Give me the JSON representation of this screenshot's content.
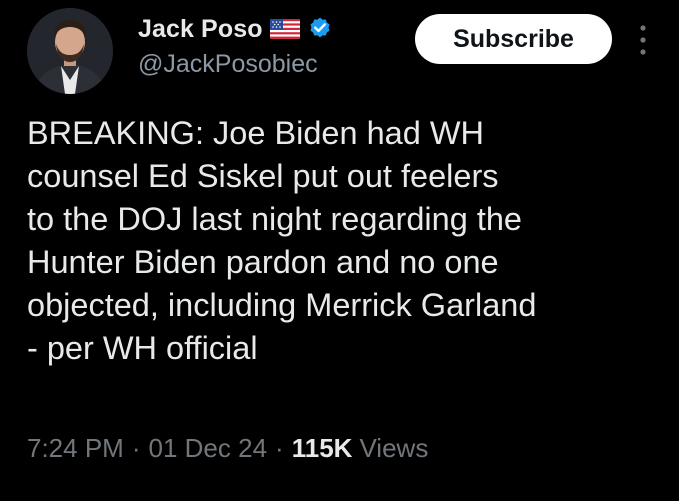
{
  "author": {
    "display_name": "Jack Poso",
    "handle": "@JackPosobiec",
    "flag_icon": "us-flag-icon",
    "verified_icon": "verified-badge-icon",
    "verified_color": "#1d9bf0"
  },
  "actions": {
    "subscribe_label": "Subscribe",
    "more_icon": "more-vertical-icon"
  },
  "tweet": {
    "lines": [
      "BREAKING: Joe Biden had WH",
      "counsel Ed Siskel put out feelers",
      "to the DOJ last night regarding the",
      "Hunter Biden pardon and no one",
      "objected, including Merrick Garland",
      "- per WH official"
    ]
  },
  "meta": {
    "time": "7:24 PM",
    "separator": "·",
    "date": "01 Dec 24",
    "views_count": "115K",
    "views_label": "Views"
  },
  "colors": {
    "background": "#000000",
    "primary_text": "#e7e9ea",
    "secondary_text": "#71767b",
    "subscribe_bg": "#ffffff"
  }
}
